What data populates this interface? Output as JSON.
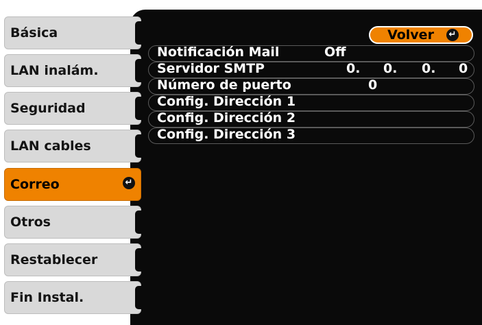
{
  "sidebar": {
    "items": [
      {
        "label": "Básica"
      },
      {
        "label": "LAN inalám."
      },
      {
        "label": "Seguridad"
      },
      {
        "label": "LAN cables"
      },
      {
        "label": "Correo",
        "active": true
      },
      {
        "label": "Otros"
      },
      {
        "label": "Restablecer"
      },
      {
        "label": "Fin Instal."
      }
    ]
  },
  "header": {
    "volver_label": "Volver"
  },
  "settings": {
    "notification": {
      "label": "Notificación Mail",
      "value": "Off"
    },
    "smtp": {
      "label": "Servidor SMTP",
      "octets": [
        "0.",
        "0.",
        "0.",
        "0"
      ]
    },
    "port": {
      "label": "Número de puerto",
      "value": "0"
    },
    "address1": {
      "label": "Config. Dirección 1"
    },
    "address2": {
      "label": "Config. Dirección 2"
    },
    "address3": {
      "label": "Config. Dirección 3"
    }
  },
  "colors": {
    "accent": "#ef8200",
    "panel": "#0a0a0a",
    "menu": "#d9d9d9"
  },
  "icons": {
    "enter": "enter-icon"
  }
}
